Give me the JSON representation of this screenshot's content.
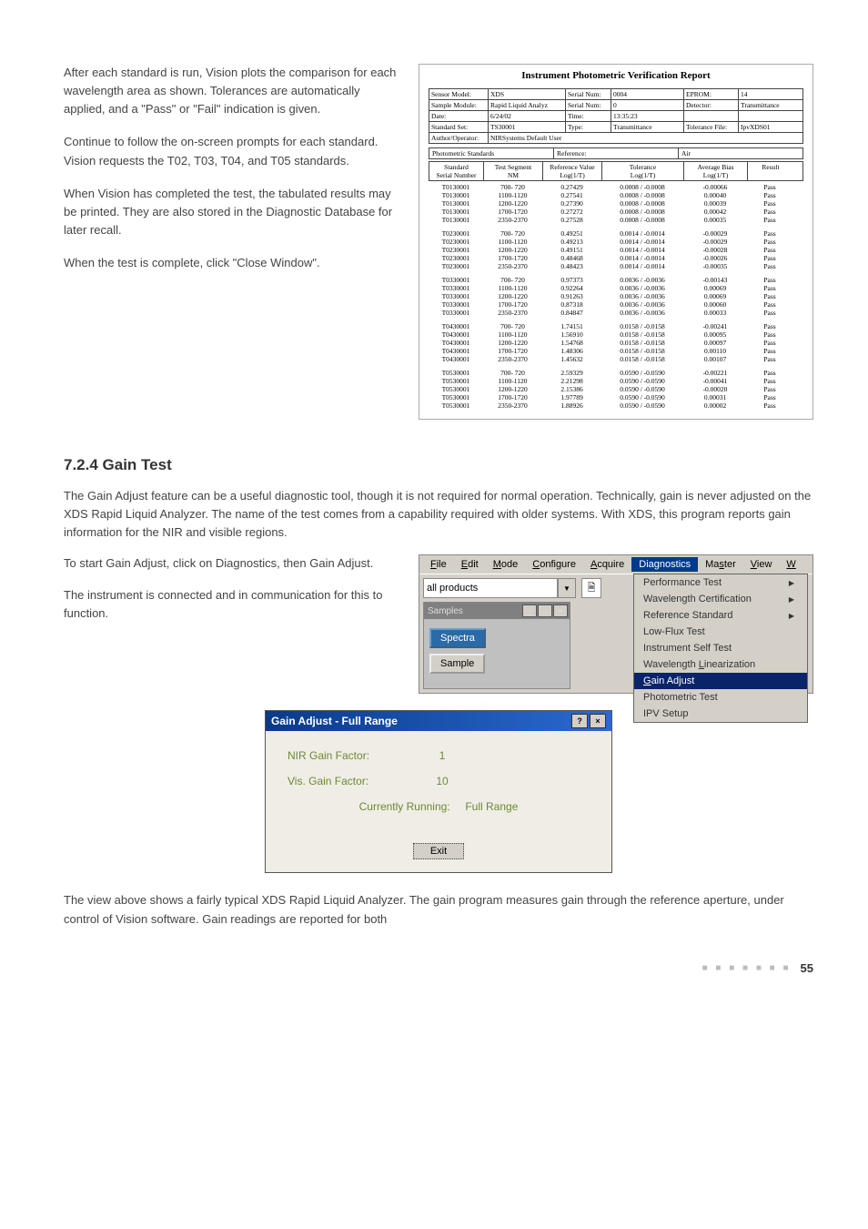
{
  "paragraphs": {
    "p1": "After each standard is run, Vision plots the comparison for each wavelength area as shown. Tolerances are automatically applied, and a \"Pass\" or \"Fail\" indication is given.",
    "p2": "Continue to follow the on-screen prompts for each standard. Vision requests the T02, T03, T04, and T05 standards.",
    "p3": "When Vision has completed the test, the tabulated results may be printed. They are also stored in the Diagnostic Database for later recall.",
    "p4": "When the test is complete, click \"Close Window\".",
    "p5": "The Gain Adjust feature can be a useful diagnostic tool, though it is not required for normal operation. Technically, gain is never adjusted on the XDS Rapid Liquid Analyzer. The name of the test comes from a capability required with older systems. With XDS, this program reports gain information for the NIR and visible regions.",
    "p6": "To start Gain Adjust, click on Diagnostics, then Gain Adjust.",
    "p7": "The instrument is connected and in communication for this to function.",
    "p8": "The view above shows a fairly typical XDS Rapid Liquid Analyzer. The gain program measures gain through the reference aperture, under control of Vision software. Gain readings are reported for both"
  },
  "section_heading": "7.2.4    Gain Test",
  "report": {
    "title": "Instrument Photometric Verification Report",
    "meta": {
      "sensor_model_k": "Sensor Model:",
      "sensor_model_v": "XDS",
      "serial_num_k": "Serial Num:",
      "serial_num_v": "0004",
      "eprom_k": "EPROM:",
      "eprom_v": "14",
      "sample_module_k": "Sample Module:",
      "sample_module_v": "Rapid Liquid Analyz",
      "serial_num2_k": "Serial Num:",
      "serial_num2_v": "0",
      "detector_k": "Detector:",
      "detector_v": "Transmittance",
      "date_k": "Date:",
      "date_v": "6/24/02",
      "time_k": "Time:",
      "time_v": "13:35:23",
      "standard_set_k": "Standard Set:",
      "standard_set_v": "TS30001",
      "type_k": "Type:",
      "type_v": "Transmittance",
      "tolfile_k": "Tolerance File:",
      "tolfile_v": "IpvXDS01",
      "author_k": "Author/Operator:",
      "author_v": "NIRSystems Default User"
    },
    "sub": {
      "l": "Photometric Standards",
      "rk": "Reference:",
      "rv": "Air"
    },
    "cols": {
      "c1a": "Standard",
      "c1b": "Serial Number",
      "c2a": "Test Segment",
      "c2b": "NM",
      "c3a": "Reference Value",
      "c3b": "Log(1/T)",
      "c4a": "Tolerance",
      "c4b": "Log(1/T)",
      "c5a": "Average Bias",
      "c5b": "Log(1/T)",
      "c6": "Result"
    },
    "rows": [
      {
        "std": "T0130001",
        "seg": "700- 720",
        "ref": "0.27429",
        "tol": "0.0008 / -0.0008",
        "bias": "-0.00066",
        "res": "Pass"
      },
      {
        "std": "T0130001",
        "seg": "1100-1120",
        "ref": "0.27541",
        "tol": "0.0008 / -0.0008",
        "bias": "0.00040",
        "res": "Pass"
      },
      {
        "std": "T0130001",
        "seg": "1200-1220",
        "ref": "0.27390",
        "tol": "0.0008 / -0.0008",
        "bias": "0.00039",
        "res": "Pass"
      },
      {
        "std": "T0130001",
        "seg": "1700-1720",
        "ref": "0.27272",
        "tol": "0.0008 / -0.0008",
        "bias": "0.00042",
        "res": "Pass"
      },
      {
        "std": "T0130001",
        "seg": "2350-2370",
        "ref": "0.27528",
        "tol": "0.0008 / -0.0008",
        "bias": "0.00035",
        "res": "Pass"
      },
      null,
      {
        "std": "T0230001",
        "seg": "700- 720",
        "ref": "0.49251",
        "tol": "0.0014 / -0.0014",
        "bias": "-0.00029",
        "res": "Pass"
      },
      {
        "std": "T0230001",
        "seg": "1100-1120",
        "ref": "0.49213",
        "tol": "0.0014 / -0.0014",
        "bias": "-0.00029",
        "res": "Pass"
      },
      {
        "std": "T0230001",
        "seg": "1200-1220",
        "ref": "0.49151",
        "tol": "0.0014 / -0.0014",
        "bias": "-0.00028",
        "res": "Pass"
      },
      {
        "std": "T0230001",
        "seg": "1700-1720",
        "ref": "0.48468",
        "tol": "0.0014 / -0.0014",
        "bias": "-0.00026",
        "res": "Pass"
      },
      {
        "std": "T0230001",
        "seg": "2350-2370",
        "ref": "0.48423",
        "tol": "0.0014 / -0.0014",
        "bias": "-0.00035",
        "res": "Pass"
      },
      null,
      {
        "std": "T0330001",
        "seg": "700- 720",
        "ref": "0.97373",
        "tol": "0.0036 / -0.0036",
        "bias": "-0.00143",
        "res": "Pass"
      },
      {
        "std": "T0330001",
        "seg": "1100-1120",
        "ref": "0.92264",
        "tol": "0.0036 / -0.0036",
        "bias": "0.00069",
        "res": "Pass"
      },
      {
        "std": "T0330001",
        "seg": "1200-1220",
        "ref": "0.91263",
        "tol": "0.0036 / -0.0036",
        "bias": "0.00069",
        "res": "Pass"
      },
      {
        "std": "T0330001",
        "seg": "1700-1720",
        "ref": "0.87318",
        "tol": "0.0036 / -0.0036",
        "bias": "0.00060",
        "res": "Pass"
      },
      {
        "std": "T0330001",
        "seg": "2350-2370",
        "ref": "0.84847",
        "tol": "0.0036 / -0.0036",
        "bias": "0.00033",
        "res": "Pass"
      },
      null,
      {
        "std": "T0430001",
        "seg": "700- 720",
        "ref": "1.74151",
        "tol": "0.0158 / -0.0158",
        "bias": "-0.00241",
        "res": "Pass"
      },
      {
        "std": "T0430001",
        "seg": "1100-1120",
        "ref": "1.56910",
        "tol": "0.0158 / -0.0158",
        "bias": "0.00095",
        "res": "Pass"
      },
      {
        "std": "T0430001",
        "seg": "1200-1220",
        "ref": "1.54768",
        "tol": "0.0158 / -0.0158",
        "bias": "0.00097",
        "res": "Pass"
      },
      {
        "std": "T0430001",
        "seg": "1700-1720",
        "ref": "1.48306",
        "tol": "0.0158 / -0.0158",
        "bias": "0.00110",
        "res": "Pass"
      },
      {
        "std": "T0430001",
        "seg": "2350-2370",
        "ref": "1.45632",
        "tol": "0.0158 / -0.0158",
        "bias": "0.00107",
        "res": "Pass"
      },
      null,
      {
        "std": "T0530001",
        "seg": "700- 720",
        "ref": "2.59329",
        "tol": "0.0590 / -0.0590",
        "bias": "-0.00221",
        "res": "Pass"
      },
      {
        "std": "T0530001",
        "seg": "1100-1120",
        "ref": "2.21298",
        "tol": "0.0590 / -0.0590",
        "bias": "-0.00041",
        "res": "Pass"
      },
      {
        "std": "T0530001",
        "seg": "1200-1220",
        "ref": "2.15386",
        "tol": "0.0590 / -0.0590",
        "bias": "-0.00020",
        "res": "Pass"
      },
      {
        "std": "T0530001",
        "seg": "1700-1720",
        "ref": "1.97789",
        "tol": "0.0590 / -0.0590",
        "bias": "0.00031",
        "res": "Pass"
      },
      {
        "std": "T0530001",
        "seg": "2350-2370",
        "ref": "1.88926",
        "tol": "0.0590 / -0.0590",
        "bias": "0.00002",
        "res": "Pass"
      }
    ]
  },
  "menu": {
    "file": "File",
    "edit": "Edit",
    "mode": "Mode",
    "configure": "Configure",
    "acquire": "Acquire",
    "diagnostics": "Diagnostics",
    "master": "Master",
    "view": "View",
    "w": "W",
    "combo_value": "all products",
    "samples_title": "Samples",
    "spectra": "Spectra",
    "sample": "Sample",
    "items": [
      "Performance Test",
      "Wavelength Certification",
      "Reference Standard",
      "Low-Flux Test",
      "Instrument Self Test",
      "Wavelength Linearization",
      "Gain Adjust",
      "Photometric Test",
      "IPV Setup"
    ],
    "selected_item": "Gain Adjust"
  },
  "gain_dialog": {
    "title": "Gain Adjust - Full Range",
    "nir_label": "NIR Gain Factor:",
    "nir_value": "1",
    "vis_label": "Vis. Gain Factor:",
    "vis_value": "10",
    "running_label": "Currently Running:",
    "running_value": "Full Range",
    "exit": "Exit"
  },
  "page_number": "55"
}
